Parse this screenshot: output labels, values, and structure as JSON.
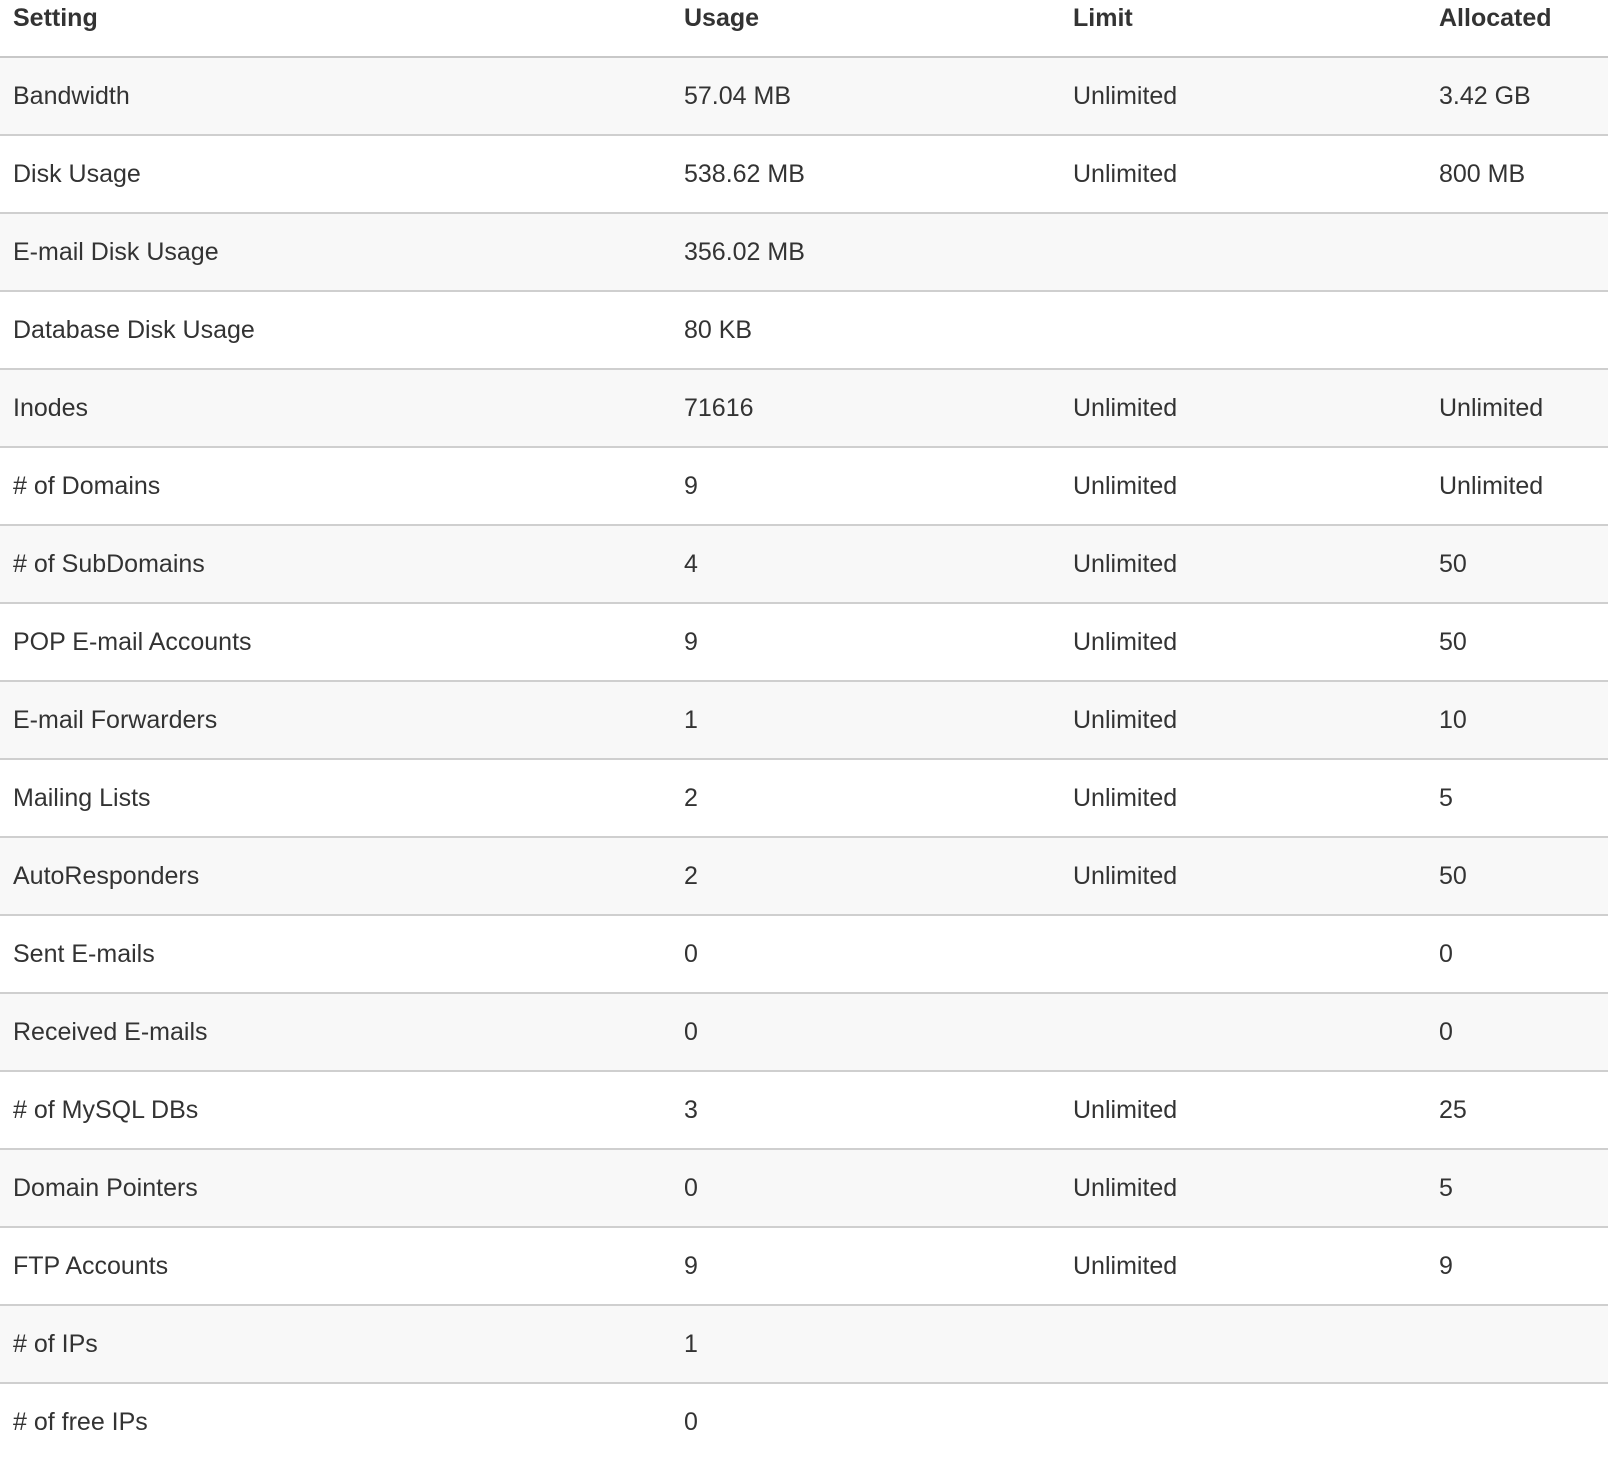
{
  "table": {
    "headers": {
      "setting": "Setting",
      "usage": "Usage",
      "limit": "Limit",
      "allocated": "Allocated"
    },
    "rows": [
      {
        "setting": "Bandwidth",
        "usage": "57.04 MB",
        "limit": "Unlimited",
        "allocated": "3.42 GB"
      },
      {
        "setting": "Disk Usage",
        "usage": "538.62 MB",
        "limit": "Unlimited",
        "allocated": "800 MB"
      },
      {
        "setting": "E-mail Disk Usage",
        "usage": "356.02 MB",
        "limit": "",
        "allocated": ""
      },
      {
        "setting": "Database Disk Usage",
        "usage": "80 KB",
        "limit": "",
        "allocated": ""
      },
      {
        "setting": "Inodes",
        "usage": "71616",
        "limit": "Unlimited",
        "allocated": "Unlimited"
      },
      {
        "setting": "# of Domains",
        "usage": "9",
        "limit": "Unlimited",
        "allocated": "Unlimited"
      },
      {
        "setting": "# of SubDomains",
        "usage": "4",
        "limit": "Unlimited",
        "allocated": "50"
      },
      {
        "setting": "POP E-mail Accounts",
        "usage": "9",
        "limit": "Unlimited",
        "allocated": "50"
      },
      {
        "setting": "E-mail Forwarders",
        "usage": "1",
        "limit": "Unlimited",
        "allocated": "10"
      },
      {
        "setting": "Mailing Lists",
        "usage": "2",
        "limit": "Unlimited",
        "allocated": "5"
      },
      {
        "setting": "AutoResponders",
        "usage": "2",
        "limit": "Unlimited",
        "allocated": "50"
      },
      {
        "setting": "Sent E-mails",
        "usage": "0",
        "limit": "",
        "allocated": "0"
      },
      {
        "setting": "Received E-mails",
        "usage": "0",
        "limit": "",
        "allocated": "0"
      },
      {
        "setting": "# of MySQL DBs",
        "usage": "3",
        "limit": "Unlimited",
        "allocated": "25"
      },
      {
        "setting": "Domain Pointers",
        "usage": "0",
        "limit": "Unlimited",
        "allocated": "5"
      },
      {
        "setting": "FTP Accounts",
        "usage": "9",
        "limit": "Unlimited",
        "allocated": "9"
      },
      {
        "setting": "# of IPs",
        "usage": "1",
        "limit": "",
        "allocated": ""
      },
      {
        "setting": "# of free IPs",
        "usage": "0",
        "limit": "",
        "allocated": ""
      }
    ]
  }
}
